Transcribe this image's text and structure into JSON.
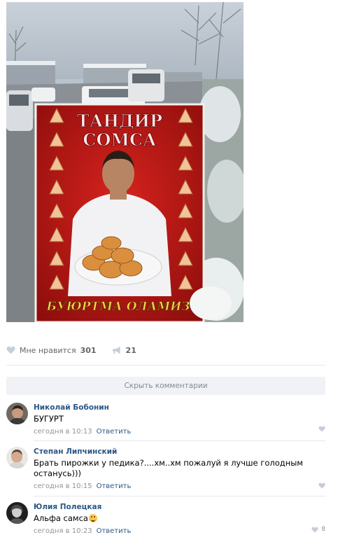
{
  "post": {
    "photo": {
      "sign_line1": "ТАНДИР",
      "sign_line2": "СОМСА",
      "sign_bottom": "БУЮРТМА ОЛАМИЗ"
    },
    "likes_label": "Мне нравится",
    "likes_count": "301",
    "shares_count": "21"
  },
  "hide_comments_label": "Скрыть комментарии",
  "comments": [
    {
      "author": "Николай Бобонин",
      "text": "БУГУРТ",
      "time": "сегодня в 10:13",
      "reply": "Ответить",
      "likes": ""
    },
    {
      "author": "Степан Липчинский",
      "text": "Брать пирожки у педика?....хм..хм пожалуй я лучше голодным останусь)))",
      "time": "сегодня в 10:15",
      "reply": "Ответить",
      "likes": ""
    },
    {
      "author": "Юлия Полецкая",
      "text": "Альфа самса",
      "time": "сегодня в 10:23",
      "reply": "Ответить",
      "likes": "8"
    }
  ]
}
